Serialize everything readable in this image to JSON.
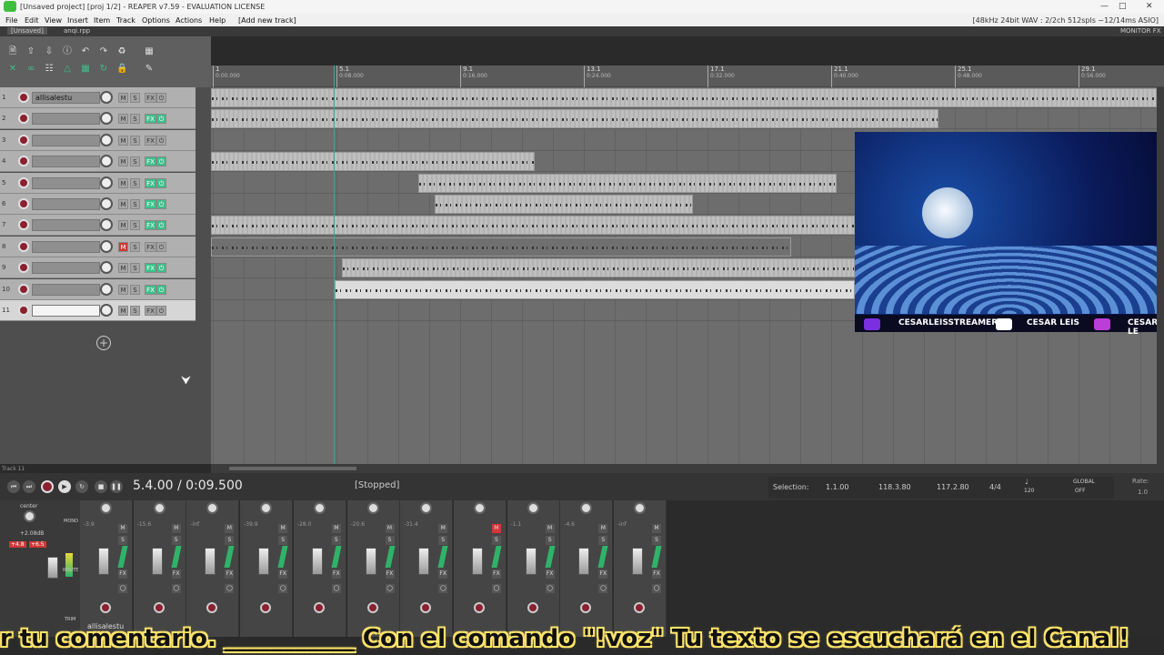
{
  "window": {
    "title": "[Unsaved project] [proj 1/2] - REAPER v7.59 - EVALUATION LICENSE",
    "audio_info": "[48kHz 24bit WAV : 2/2ch 512spls ~12/14ms ASIO]"
  },
  "menu": [
    "File",
    "Edit",
    "View",
    "Insert",
    "Item",
    "Track",
    "Options",
    "Actions",
    "Help",
    "[Add new track]"
  ],
  "tabs": [
    "[Unsaved]",
    "anqi.rpp"
  ],
  "monitor_fx": "MONITOR FX",
  "ruler": [
    {
      "bar": "1",
      "time": "0:00.000"
    },
    {
      "bar": "5.1",
      "time": "0:08.000"
    },
    {
      "bar": "9.1",
      "time": "0:16.000"
    },
    {
      "bar": "13.1",
      "time": "0:24.000"
    },
    {
      "bar": "17.1",
      "time": "0:32.000"
    },
    {
      "bar": "21.1",
      "time": "0:40.000"
    },
    {
      "bar": "25.1",
      "time": "0:48.000"
    },
    {
      "bar": "29.1",
      "time": "0:56.000"
    }
  ],
  "tracks": [
    {
      "num": "1",
      "name": "allisalestu",
      "muted": false,
      "fx": false,
      "selected": false
    },
    {
      "num": "2",
      "name": "",
      "muted": false,
      "fx": true,
      "selected": false
    },
    {
      "num": "3",
      "name": "",
      "muted": false,
      "fx": false,
      "selected": false
    },
    {
      "num": "4",
      "name": "",
      "muted": false,
      "fx": true,
      "selected": false
    },
    {
      "num": "5",
      "name": "",
      "muted": false,
      "fx": true,
      "selected": false
    },
    {
      "num": "6",
      "name": "",
      "muted": false,
      "fx": true,
      "selected": false
    },
    {
      "num": "7",
      "name": "",
      "muted": false,
      "fx": true,
      "selected": false
    },
    {
      "num": "8",
      "name": "",
      "muted": true,
      "fx": false,
      "selected": false
    },
    {
      "num": "9",
      "name": "",
      "muted": false,
      "fx": true,
      "selected": false
    },
    {
      "num": "10",
      "name": "",
      "muted": false,
      "fx": true,
      "selected": false
    },
    {
      "num": "11",
      "name": "",
      "muted": false,
      "fx": false,
      "selected": true
    }
  ],
  "track_labels": {
    "mute": "M",
    "solo": "S",
    "fx": "FX"
  },
  "transport": {
    "position": "5.4.00 / 0:09.500",
    "status": "[Stopped]",
    "selection_label": "Selection:",
    "selection_start": "1.1.00",
    "selection_end": "118.3.80",
    "selection_length": "117.2.80",
    "time_sig": "4/4",
    "bpm": "120",
    "global": "GLOBAL",
    "global_state": "OFF",
    "rate_label": "Rate:",
    "rate": "1.0",
    "track_info": "Track 11"
  },
  "mixer": {
    "master_label": "center",
    "master_db": "+2.08dB",
    "master_peak_l": "+4.8",
    "master_peak_r": "+6.5",
    "mono_label": "MONO",
    "route_label": "ROUTE",
    "trim_label": "TRIM",
    "strip_name": "allisalestu",
    "strips": [
      {
        "db": "-3.9",
        "muted": false
      },
      {
        "db": "-15.6",
        "muted": false
      },
      {
        "db": "-inf",
        "muted": false
      },
      {
        "db": "-39.9",
        "muted": false
      },
      {
        "db": "-28.0",
        "muted": false
      },
      {
        "db": "-20.6",
        "muted": false
      },
      {
        "db": "-31.4",
        "muted": false
      },
      {
        "db": "",
        "muted": true
      },
      {
        "db": "-1.1",
        "muted": false
      },
      {
        "db": "-4.6",
        "muted": false
      },
      {
        "db": "-inf",
        "muted": false
      }
    ]
  },
  "video_overlay": {
    "handle_1": "CESARLEISSTREAMER",
    "handle_2": "CESAR LEIS",
    "handle_3": "CESAR LE"
  },
  "subtitle": "r tu comentario. ___________ Con el comando \"!voz\" Tu texto se escuchará en el Canal!",
  "colors": {
    "accent_green": "#3fbf8a",
    "mute_red": "#d03838",
    "play_cursor": "#3fa598"
  }
}
